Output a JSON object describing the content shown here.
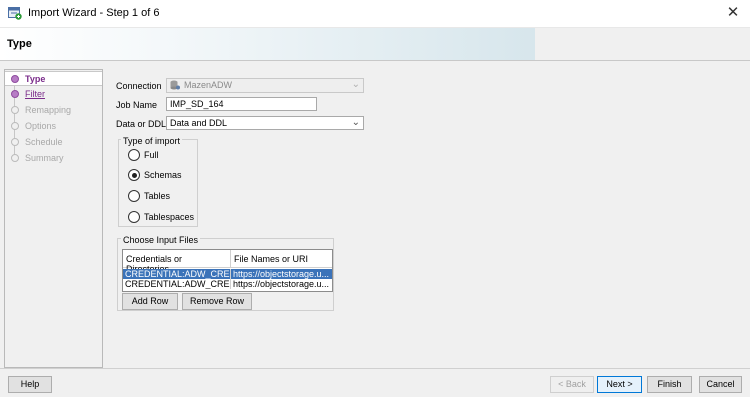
{
  "window": {
    "title": "Import Wizard - Step 1 of 6",
    "close_glyph": "✕",
    "icon": "import-wizard-app-icon"
  },
  "header": {
    "title": "Type"
  },
  "steps": [
    {
      "label": "Type",
      "state": "active"
    },
    {
      "label": "Filter",
      "state": "link"
    },
    {
      "label": "Remapping",
      "state": "disabled"
    },
    {
      "label": "Options",
      "state": "disabled"
    },
    {
      "label": "Schedule",
      "state": "disabled"
    },
    {
      "label": "Summary",
      "state": "disabled"
    }
  ],
  "form": {
    "connection_label": "Connection",
    "connection_value": "MazenADW",
    "job_name_label": "Job Name",
    "job_name_value": "IMP_SD_164",
    "data_or_ddl_label": "Data or DDL",
    "data_or_ddl_value": "Data and DDL"
  },
  "import_type": {
    "title": "Type of import",
    "options": [
      "Full",
      "Schemas",
      "Tables",
      "Tablespaces"
    ],
    "selected": "Schemas"
  },
  "input_files": {
    "title": "Choose Input Files",
    "columns": [
      "Credentials or Directories",
      "File Names or URI"
    ],
    "rows": [
      [
        "CREDENTIAL:ADW_CRED...",
        "https://objectstorage.u..."
      ],
      [
        "CREDENTIAL:ADW_CRED...",
        "https://objectstorage.u..."
      ]
    ],
    "selected_row": 0,
    "add_row_label": "Add Row",
    "remove_row_label": "Remove Row"
  },
  "footer": {
    "help_label": "Help",
    "back_label": "< Back",
    "next_label": "Next >",
    "finish_label": "Finish",
    "cancel_label": "Cancel"
  },
  "colors": {
    "accent_purple": "#7a2b8a",
    "selection_blue": "#3b73b9",
    "primary_button_border": "#0078d7"
  }
}
